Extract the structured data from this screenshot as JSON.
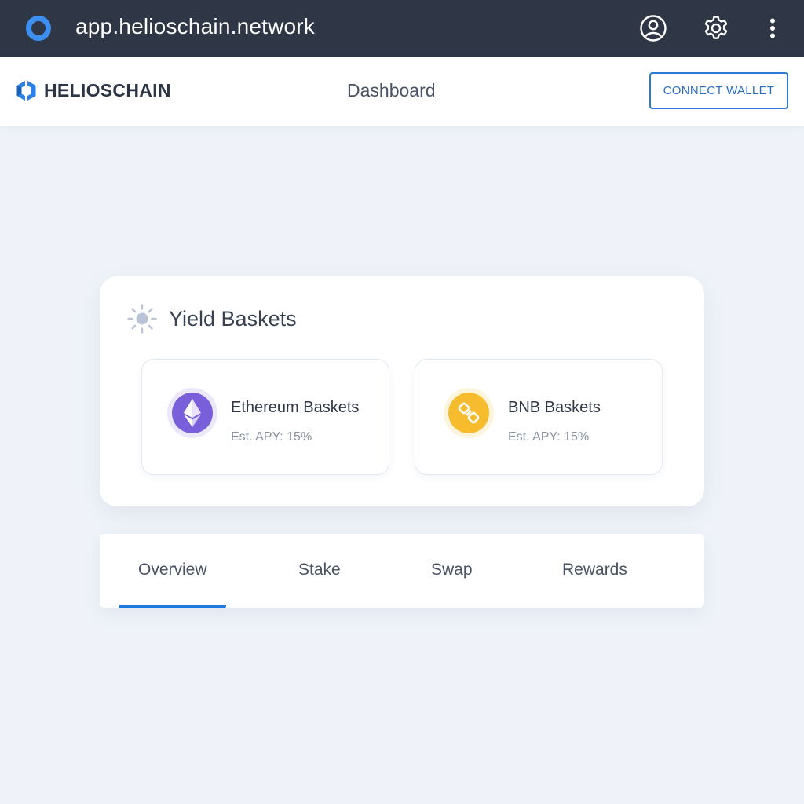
{
  "browser": {
    "url": "app.helioschain.network",
    "icons": [
      "browser-logo-icon",
      "account-icon",
      "settings-gear-icon",
      "more-vertical-icon"
    ]
  },
  "header": {
    "brand": "HELIOSCHAIN",
    "page_title": "Dashboard",
    "connect_label": "CONNECT WALLET"
  },
  "yield": {
    "title": "Yield Baskets",
    "icon": "sun-icon",
    "baskets": [
      {
        "name": "Ethereum Baskets",
        "apy": "Est. APY: 15%",
        "icon": "ethereum-icon",
        "color": "#7a5fdb"
      },
      {
        "name": "BNB Baskets",
        "apy": "Est. APY: 15%",
        "icon": "bnb-icon",
        "color": "#f6bc2e"
      }
    ]
  },
  "tabs": {
    "items": [
      "Overview",
      "Stake",
      "Swap",
      "Rewards"
    ],
    "active": "Overview"
  },
  "colors": {
    "accent": "#1f7ae0",
    "topbar": "#2f3646",
    "background": "#eff3f9"
  }
}
